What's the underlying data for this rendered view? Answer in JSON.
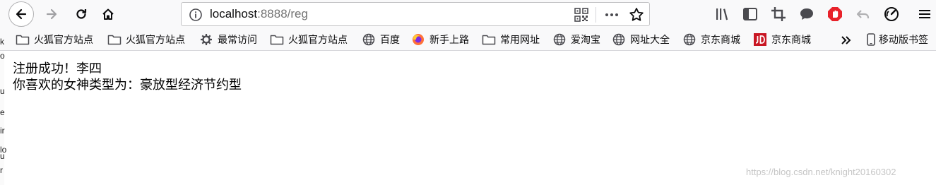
{
  "url": {
    "host": "localhost",
    "rest": ":8888/reg"
  },
  "bookmarks": [
    {
      "label": "火狐官方站点",
      "icon": "folder-icon"
    },
    {
      "label": "火狐官方站点",
      "icon": "folder-icon"
    },
    {
      "label": "最常访问",
      "icon": "gear-icon"
    },
    {
      "label": "火狐官方站点",
      "icon": "folder-icon"
    },
    {
      "label": "百度",
      "icon": "globe-icon"
    },
    {
      "label": "新手上路",
      "icon": "firefox-icon"
    },
    {
      "label": "常用网址",
      "icon": "folder-icon"
    },
    {
      "label": "爱淘宝",
      "icon": "globe-icon"
    },
    {
      "label": "网址大全",
      "icon": "globe-icon"
    },
    {
      "label": "京东商城",
      "icon": "globe-icon"
    },
    {
      "label": "京东商城",
      "icon": "jd-icon"
    }
  ],
  "mobile_bookmarks": {
    "label": "移动版书签",
    "icon": "mobile-icon"
  },
  "content": {
    "line1": "注册成功！李四",
    "line2": "你喜欢的女神类型为：豪放型经济节约型"
  },
  "watermark": "https://blog.csdn.net/knight20160302",
  "left_strip_glyphs": [
    "k",
    "o",
    "u",
    "e",
    "ir",
    "lo",
    "u",
    "r"
  ],
  "colors": {
    "toolbar_bg": "#f9f9fa",
    "adblock_red": "#e8222a",
    "jd_red": "#c91623",
    "firefox_orange": "#ff7139"
  }
}
